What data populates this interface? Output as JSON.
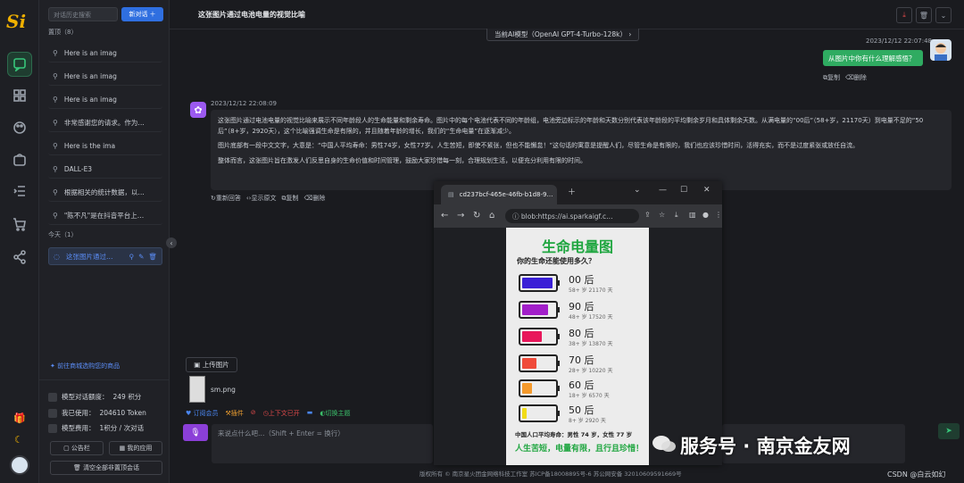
{
  "app": {
    "logo_text": "Si",
    "chat_title": "这张图片通过电池电量的视觉比喻"
  },
  "sidebar": {
    "search_placeholder": "对话历史搜索",
    "new_chat_label": "新对话",
    "group_recent": "置顶（8）",
    "group_today": "今天（1）",
    "pinned": [
      "Here is an imag",
      "Here is an imag",
      "Here is an imag",
      "非常感谢您的请求。作为…",
      "Here is the ima",
      "DALL-E3",
      "根据相关的统计数据，以…",
      "\"陈不凡\"是在抖音平台上…"
    ],
    "today": [
      {
        "label": "这张图片通过…"
      }
    ],
    "mall_link": "✦ 前往商城选购您的商品",
    "stats": [
      {
        "label": "模型对话额度：",
        "value": "249 积分"
      },
      {
        "label": "我已使用：",
        "value": "204610 Token"
      },
      {
        "label": "模型费用：",
        "value": "1积分 / 次对话"
      }
    ],
    "notice_btn": "公告栏",
    "myapp_btn": "我的应用",
    "clear_btn": "清空全部非置顶会话"
  },
  "header": {
    "model_label": "当前AI模型（OpenAI GPT-4-Turbo-128k）"
  },
  "messages": {
    "user": {
      "time": "2023/12/12 22:07:48",
      "text": "从图片中你有什么理解感悟？",
      "copy": "复制",
      "delete": "删除"
    },
    "bot": {
      "time": "2023/12/12 22:08:09",
      "p1": "这张图片通过电池电量的视觉比喻来展示不同年龄段人的生命能量和剩余寿命。图片中的每个电池代表不同的年龄组，电池旁边标示的年龄和天数分别代表该年龄段的平均剩余岁月和具体剩余天数。从满电量的“00后”（58+岁，21170天）到电量不足的“50后”（8+岁，2920天），这个比喻强调生命是有限的，并且随着年龄的增长，我们的“生命电量”在逐渐减少。",
      "p2": "图片底部有一段中文文字，大意是：“中国人平均寿命：男性74岁，女性77岁。人生苦短，即使不紧张，但也不能懈怠！”这句话的寓意是提醒人们，尽管生命是有限的，我们也应该珍惜时间，活得充实，而不是过度紧张或放任自流。",
      "p3": "整体而言，这张图片旨在激发人们反思自身的生命价值和时间管理，鼓励大家珍惜每一刻，合理规划生活，以便充分利用有限的时间。",
      "regen": "重新回答",
      "show_src": "显示原文",
      "copy": "复制",
      "delete": "删除"
    }
  },
  "popup": {
    "tab_title": "cd237bcf-465e-46fb-b1d8-9…",
    "url": "blob:https://ai.sparkaigf.c…",
    "poster": {
      "title": "生命电量图",
      "subtitle": "你的生命还能使用多久？",
      "rows": [
        {
          "gen": "00 后",
          "detail": "58+ 岁    21170 天",
          "level": 0.95,
          "color": "#3a1fd6"
        },
        {
          "gen": "90 后",
          "detail": "48+ 岁    17520 天",
          "level": 0.8,
          "color": "#a21fc9"
        },
        {
          "gen": "80 后",
          "detail": "38+ 岁    13870 天",
          "level": 0.62,
          "color": "#e8175b"
        },
        {
          "gen": "70 后",
          "detail": "28+ 岁    10220 天",
          "level": 0.45,
          "color": "#f04b3a"
        },
        {
          "gen": "60 后",
          "detail": "18+ 岁    6570 天",
          "level": 0.3,
          "color": "#f59a2c"
        },
        {
          "gen": "50 后",
          "detail": "8+ 岁    2920 天",
          "level": 0.14,
          "color": "#f2dc17"
        }
      ],
      "foot1": "中国人口平均寿命：男性 74 岁，女性 77 岁",
      "foot2": "人生苦短，电量有限，且行且珍惜！"
    }
  },
  "composer": {
    "upload_label": "上传图片",
    "file_name": "sm.png",
    "tools": [
      "订阅会员",
      "插件",
      "",
      "上下文已开",
      "",
      "切换主题"
    ],
    "placeholder": "来说点什么吧…（Shift + Enter = 换行）"
  },
  "footer": {
    "text": "版权所有 © 南京星火团金网络科技工作室   苏ICP备18008895号-6   苏公网安备 32010609591669号"
  },
  "watermark": {
    "text": "服务号 · 南京金友网",
    "csdn": "CSDN @白云如幻"
  }
}
